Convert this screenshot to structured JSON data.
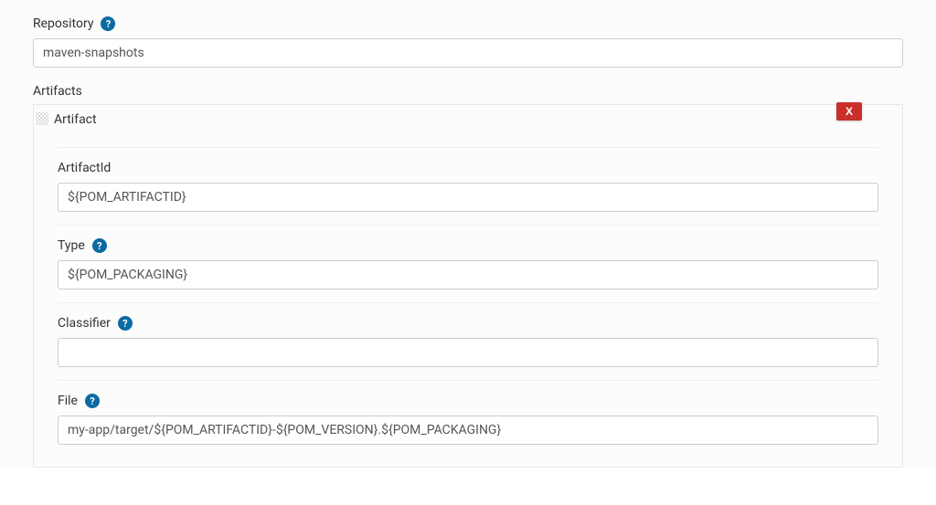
{
  "repository": {
    "label": "Repository",
    "value": "maven-snapshots",
    "hasHelp": true
  },
  "artifactsSection": {
    "label": "Artifacts"
  },
  "artifact": {
    "header": "Artifact",
    "deleteLabel": "X",
    "fields": {
      "artifactId": {
        "label": "ArtifactId",
        "value": "${POM_ARTIFACTID}",
        "hasHelp": false
      },
      "type": {
        "label": "Type",
        "value": "${POM_PACKAGING}",
        "hasHelp": true
      },
      "classifier": {
        "label": "Classifier",
        "value": "",
        "hasHelp": true
      },
      "file": {
        "label": "File",
        "value": "my-app/target/${POM_ARTIFACTID}-${POM_VERSION}.${POM_PACKAGING}",
        "hasHelp": true
      }
    }
  }
}
